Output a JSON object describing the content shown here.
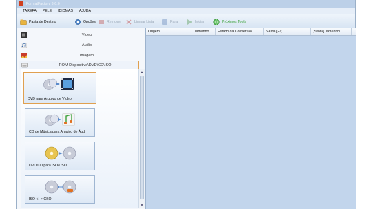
{
  "window": {
    "title": "FormatFactory 3.6.0"
  },
  "menu": [
    "TAREFA",
    "PELE",
    "IDIOMAS",
    "AJUDA"
  ],
  "toolbar": {
    "output_folder": "Pasta de Destino",
    "options": "Opções",
    "remove": "Remover",
    "clear_list": "Limpar Lista",
    "stop": "Parar",
    "start": "Iniciar",
    "featured": "Próximos Tools"
  },
  "categories": {
    "video": "Vídeo",
    "audio": "Áudio",
    "image": "Imagem",
    "rom": "ROM Dispositivo\\DVD\\CD\\ISO"
  },
  "converters": [
    {
      "label": "DVD para Arquivo de Vídeo",
      "icon": "dvd-to-video-icon"
    },
    {
      "label": "CD de Música para Arquivo de Áud",
      "icon": "cd-to-audio-icon"
    },
    {
      "label": "DVD/CD para ISO/CSO",
      "icon": "dvd-to-iso-icon"
    },
    {
      "label": "ISO <--> CSO",
      "icon": "iso-cso-icon"
    }
  ],
  "columns": [
    "Origem",
    "Tamanho",
    "Estado da Conversão",
    "Saída [F2]",
    "[Saída] Tamanho"
  ],
  "colors": {
    "accent_border": "#e0a050",
    "window_bg": "#c9d9ec",
    "featured_green": "#3aa03a"
  }
}
